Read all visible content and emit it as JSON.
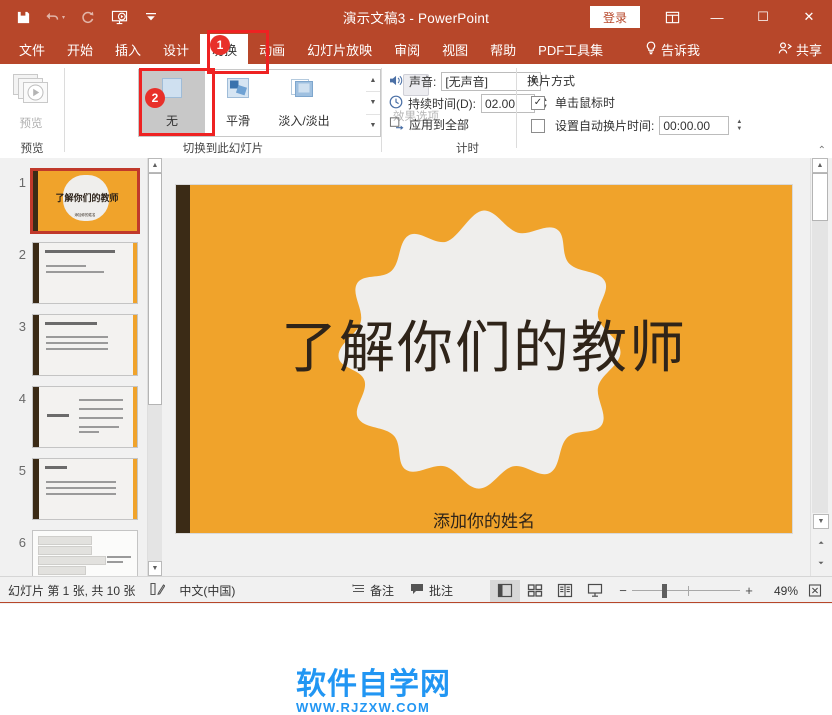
{
  "titlebar": {
    "document_title": "演示文稿3  -  PowerPoint",
    "signin_label": "登录",
    "qat": [
      {
        "name": "save-icon",
        "label": "保存"
      },
      {
        "name": "undo-icon",
        "label": "撤消"
      },
      {
        "name": "redo-icon",
        "label": "恢复"
      },
      {
        "name": "start-slideshow-icon",
        "label": "从头开始"
      },
      {
        "name": "customize-qat-icon",
        "label": "自定义快速访问工具栏"
      }
    ],
    "window_buttons": {
      "ribbon_display": "⊞",
      "minimize": "—",
      "maximize": "☐",
      "close": "✕"
    }
  },
  "tabs": {
    "items": [
      {
        "label": "文件",
        "active": false
      },
      {
        "label": "开始",
        "active": false
      },
      {
        "label": "插入",
        "active": false
      },
      {
        "label": "设计",
        "active": false
      },
      {
        "label": "切换",
        "active": true
      },
      {
        "label": "动画",
        "active": false
      },
      {
        "label": "幻灯片放映",
        "active": false
      },
      {
        "label": "审阅",
        "active": false
      },
      {
        "label": "视图",
        "active": false
      },
      {
        "label": "帮助",
        "active": false
      },
      {
        "label": "PDF工具集",
        "active": false
      }
    ],
    "tell_me": "告诉我",
    "share": "共享"
  },
  "ribbon": {
    "preview_group": {
      "button_label": "预览",
      "group_label": "预览"
    },
    "transition_group": {
      "group_label": "切换到此幻灯片",
      "gallery": [
        {
          "label": "无",
          "selected": true
        },
        {
          "label": "平滑",
          "selected": false
        },
        {
          "label": "淡入/淡出",
          "selected": false
        }
      ],
      "effect_options_label": "效果选项"
    },
    "timing_group": {
      "group_label": "计时",
      "sound_label": "声音:",
      "sound_value": "[无声音]",
      "duration_label": "持续时间(D):",
      "duration_value": "02.00",
      "apply_all_label": "应用到全部",
      "advance_header": "换片方式",
      "on_click_label": "单击鼠标时",
      "on_click_checked": true,
      "after_time_label": "设置自动换片时间:",
      "after_time_checked": false,
      "after_time_value": "00:00.00"
    }
  },
  "thumbnails": [
    {
      "number": "1",
      "selected": true,
      "kind": "title",
      "title": "了解你们的教师",
      "subtitle": "添加你的姓名"
    },
    {
      "number": "2",
      "selected": false,
      "kind": "content",
      "heading_w": 70,
      "lines": [
        40,
        58
      ]
    },
    {
      "number": "3",
      "selected": false,
      "kind": "content",
      "heading_w": 52,
      "lines": [
        62,
        62,
        62
      ]
    },
    {
      "number": "4",
      "selected": false,
      "kind": "split",
      "heading_w": 28,
      "lines": [
        44,
        44,
        44,
        40
      ]
    },
    {
      "number": "5",
      "selected": false,
      "kind": "content",
      "heading_w": 22,
      "lines": [
        70,
        70,
        70
      ]
    },
    {
      "number": "6",
      "selected": false,
      "kind": "boxes",
      "heading_w": 0,
      "lines": [
        56,
        56,
        72,
        50,
        44
      ]
    }
  ],
  "slide": {
    "title": "了解你们的教师",
    "subtitle": "添加你的姓名",
    "background_color": "#f0a32b",
    "accent_bar_color": "#3b2b16",
    "burst_color": "#efeeec",
    "text_color": "#2f2419"
  },
  "watermark": {
    "line1": "软件自学网",
    "line2": "WWW.RJZXW.COM",
    "color": "#2196f3"
  },
  "statusbar": {
    "slide_count": "幻灯片 第 1 张, 共 10 张",
    "accessibility_icon": "spell-check-icon",
    "language": "中文(中国)",
    "notes_label": "备注",
    "comments_label": "批注",
    "views": [
      {
        "name": "normal-view",
        "glyph": "▤",
        "active": true
      },
      {
        "name": "slide-sorter-view",
        "glyph": "▦",
        "active": false
      },
      {
        "name": "reading-view",
        "glyph": "▥",
        "active": false
      },
      {
        "name": "slideshow-view",
        "glyph": "▭",
        "active": false
      }
    ],
    "zoom_minus": "−",
    "zoom_plus": "+",
    "zoom_percent": "49%",
    "fit_icon": "fit-to-window-icon"
  },
  "callouts": [
    {
      "number": "1",
      "target": "tab-transitions"
    },
    {
      "number": "2",
      "target": "transition-morph"
    }
  ],
  "colors": {
    "brand_red": "#b7472a",
    "callout_red": "#e8302a",
    "slide_orange": "#f0a32b"
  }
}
